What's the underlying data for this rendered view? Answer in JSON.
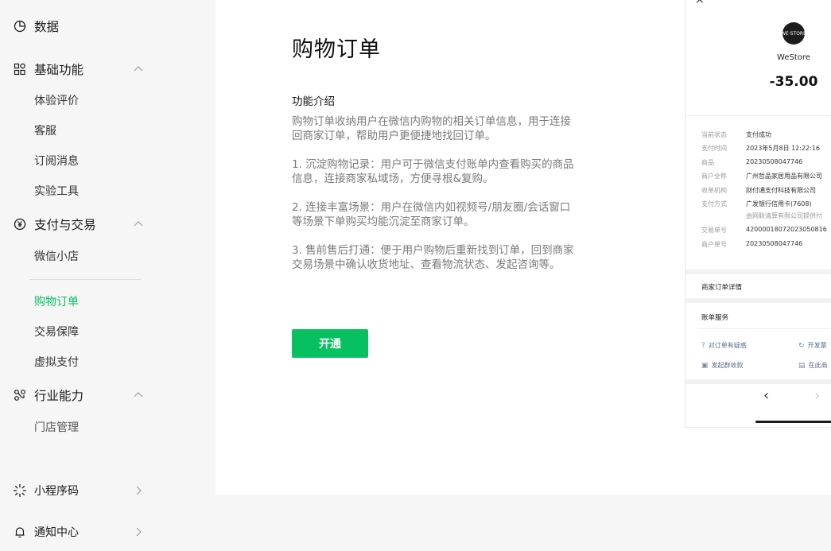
{
  "sidebar": {
    "data_label": "数据",
    "basic": {
      "label": "基础功能",
      "items": [
        "体验评价",
        "客服",
        "订阅消息",
        "实验工具"
      ]
    },
    "payment": {
      "label": "支付与交易",
      "items": [
        "微信小店",
        "购物订单",
        "交易保障",
        "虚拟支付"
      ],
      "active": "购物订单"
    },
    "industry": {
      "label": "行业能力",
      "items": [
        "门店管理"
      ]
    },
    "miniprogram_code": "小程序码",
    "notification_center": "通知中心"
  },
  "main": {
    "title": "购物订单",
    "section_title": "功能介绍",
    "intro": "购物订单收纳用户在微信内购物的相关订单信息，用于连接回商家订单，帮助用户更便捷地找回订单。",
    "point1": "1. 沉淀购物记录：用户可于微信支付账单内查看购买的商品信息，连接商家私域场，方便寻根&复购。",
    "point2": "2. 连接丰富场景：用户在微信内如视频号/朋友圈/会话窗口等场景下单购买均能沉淀至商家订单。",
    "point3": "3. 售前售后打通：便于用户购物后重新找到订单，回到商家交易场景中确认收货地址、查看物流状态、发起咨询等。",
    "open_button": "开通"
  },
  "preview": {
    "close": "×",
    "logo_text": "WE·STORE",
    "store_name": "WeStore",
    "amount": "-35.00",
    "details": [
      {
        "k": "当前状态",
        "v": "支付成功"
      },
      {
        "k": "支付时间",
        "v": "2023年5月8日 12:22:16"
      },
      {
        "k": "商品",
        "v": "20230508047746"
      },
      {
        "k": "商户全称",
        "v": "广州哲品家居用品有限公司"
      },
      {
        "k": "收单机构",
        "v": "财付通支付科技有限公司"
      },
      {
        "k": "支付方式",
        "v": "广发银行信用卡(7608)"
      },
      {
        "k": "交易单号",
        "v": "42000018072023050816"
      },
      {
        "k": "商户单号",
        "v": "20230508047746"
      }
    ],
    "payment_sub": "由网联清算有限公司提供付",
    "merchant_order_detail": "商家订单详情",
    "bill_service": "账单服务",
    "actions": [
      {
        "icon": "question-icon",
        "label": "对订单有疑惑"
      },
      {
        "icon": "invoice-icon",
        "label": "开发票"
      },
      {
        "icon": "group-pay-icon",
        "label": "发起群收款"
      },
      {
        "icon": "receipt-icon",
        "label": "在此商"
      }
    ],
    "nav_back": "‹",
    "nav_forward": "›"
  }
}
